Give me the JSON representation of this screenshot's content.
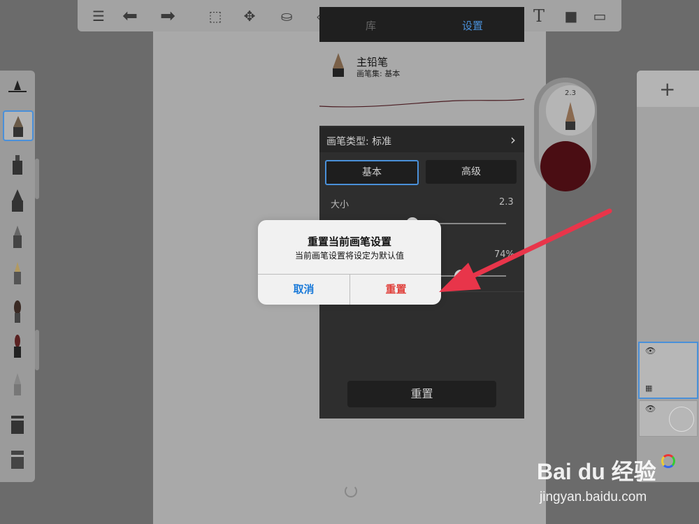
{
  "popover": {
    "tabs": [
      "库",
      "设置"
    ],
    "active_tab": "设置",
    "brush_name": "主铅笔",
    "brush_set": "画笔集: 基本",
    "brush_type": "画笔类型: 标准",
    "segments": [
      "基本",
      "高级"
    ],
    "active_segment": "基本",
    "size_label": "大小",
    "size_value": "2.3",
    "opacity_value": "74%",
    "reset_label": "重置"
  },
  "puck": {
    "size": "2.3",
    "color": "#4a0d13"
  },
  "alert": {
    "title": "重置当前画笔设置",
    "message": "当前画笔设置将设定为默认值",
    "cancel": "取消",
    "confirm": "重置"
  },
  "toolbar": {
    "icons": [
      "list-icon",
      "undo-icon",
      "redo-icon",
      "select-icon",
      "move-icon",
      "bucket-icon",
      "shape-icon",
      "text-icon",
      "brush-library-icon",
      "fullscreen-icon"
    ],
    "text_glyph": "T"
  },
  "watermark": {
    "logo": "Bai du 经验",
    "url": "jingyan.baidu.com"
  },
  "colors": {
    "accent": "#4a90d9",
    "destructive": "#e0413c",
    "alert_bg": "#f1f1f1",
    "arrow": "#e8354a"
  }
}
